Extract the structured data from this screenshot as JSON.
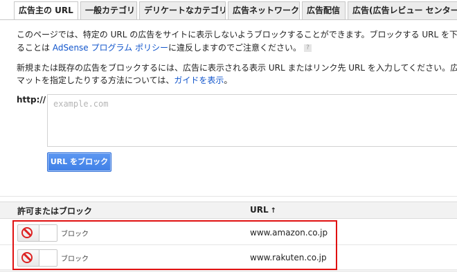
{
  "tabs": [
    {
      "label": "広告主の URL",
      "active": true
    },
    {
      "label": "一般カテゴリ",
      "active": false
    },
    {
      "label": "デリケートなカテゴリ",
      "active": false
    },
    {
      "label": "広告ネットワーク",
      "active": false
    },
    {
      "label": "広告配信",
      "active": false
    },
    {
      "label": "広告(広告レビュー センター",
      "active": false
    }
  ],
  "intro": {
    "line1": "このページでは、特定の URL の広告をサイトに表示しないようブロックすることができます。ブロックする URL を下のボ",
    "line2_prefix": "ることは ",
    "line2_link": "AdSense プログラム ポリシー",
    "line2_suffix": "に違反しますのでご注意ください。",
    "help_icon": "?"
  },
  "instructions": {
    "line1": "新規または既存の広告をブロックするには、広告に表示される表示 URL またはリンク先 URL を入力してください。広告",
    "line2_prefix": "マットを指定したりする方法については、",
    "line2_link": "ガイドを表示",
    "line2_suffix": "。"
  },
  "form": {
    "http_label": "http://",
    "url_placeholder": "example.com",
    "url_value": "",
    "block_button": "URL をブロック"
  },
  "table": {
    "col_status": "許可またはブロック",
    "col_url": "URL",
    "sort_icon": "↑",
    "rows": [
      {
        "status": "ブロック",
        "url": "www.amazon.co.jp"
      },
      {
        "status": "ブロック",
        "url": "www.rakuten.co.jp"
      }
    ]
  },
  "colors": {
    "link": "#1155cc",
    "button": "#4d8df0",
    "block_icon": "#dd2222",
    "highlight": "#e01010"
  },
  "icons": {
    "block": "no-entry-icon",
    "sort": "arrow-up-icon",
    "help": "help-icon"
  }
}
